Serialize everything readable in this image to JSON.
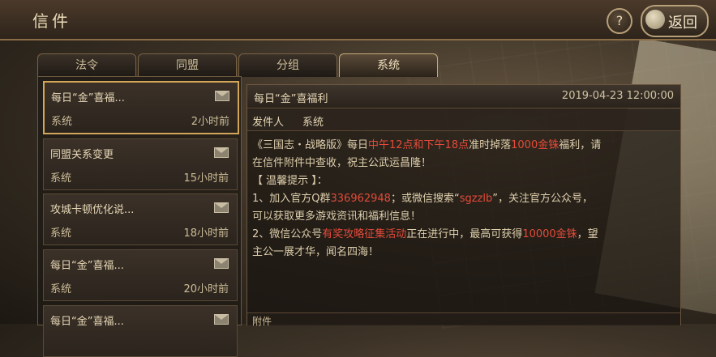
{
  "header": {
    "title": "信件",
    "help_label": "?",
    "back_label": "返回"
  },
  "tabs": [
    {
      "label": "法令",
      "active": false
    },
    {
      "label": "同盟",
      "active": false
    },
    {
      "label": "分组",
      "active": false
    },
    {
      "label": "系统",
      "active": true
    }
  ],
  "mail_list": [
    {
      "title": "每日“金”喜福...",
      "sender": "系统",
      "time": "2小时前",
      "selected": true
    },
    {
      "title": "同盟关系变更",
      "sender": "系统",
      "time": "15小时前",
      "selected": false
    },
    {
      "title": "攻城卡顿优化说...",
      "sender": "系统",
      "time": "18小时前",
      "selected": false
    },
    {
      "title": "每日“金”喜福...",
      "sender": "系统",
      "time": "20小时前",
      "selected": false
    },
    {
      "title": "每日“金”喜福...",
      "sender": "",
      "time": "",
      "selected": false
    }
  ],
  "detail": {
    "title": "每日“金”喜福利",
    "time": "2019-04-23 12:00:00",
    "sender_label": "发件人",
    "sender_name": "系统",
    "lines": [
      {
        "segments": [
          {
            "t": "《三国志・战略版》每日",
            "h": false
          },
          {
            "t": "中午12点和下午18点",
            "h": true
          },
          {
            "t": "准时掉落",
            "h": false
          },
          {
            "t": "1000金铢",
            "h": true
          },
          {
            "t": "福利，请",
            "h": false
          }
        ]
      },
      {
        "segments": [
          {
            "t": "在信件附件中查收，祝主公武运昌隆！",
            "h": false
          }
        ]
      },
      {
        "segments": [
          {
            "t": "【 温馨提示 】：",
            "h": false
          }
        ]
      },
      {
        "segments": [
          {
            "t": "1、加入官方Q群",
            "h": false
          },
          {
            "t": "336962948",
            "h": true
          },
          {
            "t": "；或微信搜索“",
            "h": false
          },
          {
            "t": "sgzzlb",
            "h": true
          },
          {
            "t": "”，关注官方公众号，",
            "h": false
          }
        ]
      },
      {
        "segments": [
          {
            "t": "可以获取更多游戏资讯和福利信息！",
            "h": false
          }
        ]
      },
      {
        "segments": [
          {
            "t": "2、微信公众号",
            "h": false
          },
          {
            "t": "有奖攻略征集活动",
            "h": true
          },
          {
            "t": "正在进行中，最高可获得",
            "h": false
          },
          {
            "t": "10000金铢",
            "h": true
          },
          {
            "t": "，望",
            "h": false
          }
        ]
      },
      {
        "segments": [
          {
            "t": "主公一展才华，闻名四海！",
            "h": false
          }
        ]
      }
    ],
    "attach_label": "附件"
  },
  "colors": {
    "highlight": "#e34b3a",
    "selected_border": "#d2a75a"
  }
}
